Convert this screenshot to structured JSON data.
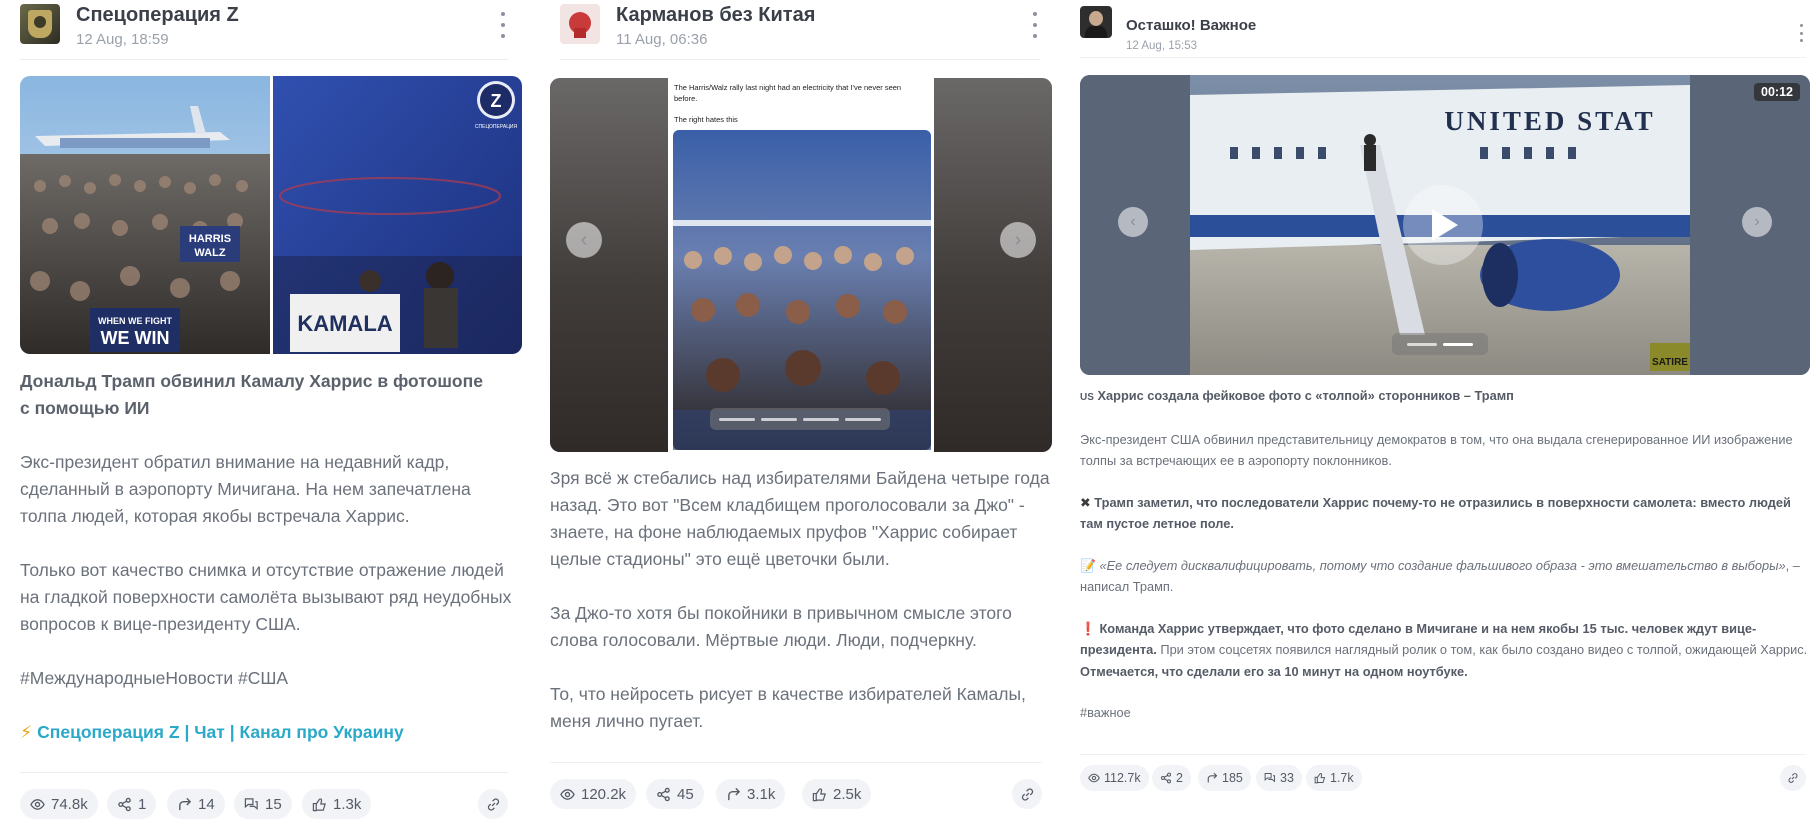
{
  "posts": [
    {
      "channel": "Спецоперация Z",
      "date": "12 Aug, 18:59",
      "title_line1": "Дональд Трамп обвинил Камалу Харрис в фотошопе",
      "title_line2": "с помощью ИИ",
      "paragraphs": [
        "Экс-президент обратил внимание на недавний кадр, сделанный в аэропорту Мичигана. На нем запечатлена толпа людей, которая якобы встречала Харрис.",
        "Только вот качество снимка и отсутствие отражение людей на гладкой поверхности самолёта вызывают ряд неудобных вопросов к вице-президенту США.",
        "#МеждународныеНовости #США"
      ],
      "links": {
        "emoji": "⚡",
        "channel": "Спецоперация Z",
        "sep": "|",
        "chat": "Чат",
        "ukraine": "Канал про Украину"
      },
      "image_texts": {
        "sign1": "HARRIS",
        "sign1b": "WALZ",
        "sign2": "WHEN WE FIGHT",
        "sign2b": "WE WIN",
        "sign3": "KAMALA",
        "badge": "Z",
        "badge_sub": "СПЕЦОПЕРАЦИЯ"
      },
      "stats": {
        "views": "74.8k",
        "shares": "1",
        "forwards": "14",
        "comments": "15",
        "likes": "1.3k"
      }
    },
    {
      "channel": "Карманов без Китая",
      "date": "11 Aug, 06:36",
      "paragraphs": [
        "Зря всё ж стебались над избирателями Байдена четыре года назад. Это вот \"Всем кладбищем проголосовали за Джо\" - знаете, на фоне наблюдаемых пруфов \"Харрис собирает целые стадионы\" это ещё цветочки были.",
        "За Джо-то хотя бы покойники в привычном смысле этого слова голосовали. Мёртвые люди. Люди, подчеркну.",
        "То, что нейросеть рисует в качестве избирателей Камалы, меня лично пугает."
      ],
      "image_texts": {
        "tweet1": "The Harris/Walz rally last night had an electricity that I've never seen before.",
        "tweet2": "The right hates this"
      },
      "stats": {
        "views": "120.2k",
        "shares": "45",
        "forwards": "3.1k",
        "likes": "2.5k"
      }
    },
    {
      "channel": "Осташко! Важное",
      "date": "12 Aug, 15:53",
      "video_duration": "00:12",
      "video_texts": {
        "plane": "UNITED STAT",
        "satire": "SATIRE"
      },
      "headline_flag": "US",
      "headline": "Харрис создала фейковое фото с «толпой» сторонников – Трамп",
      "p1": "Экс-президент США обвинил представительницу демократов в том, что она выдала сгенерированное ИИ изображение толпы за встречающих ее в аэропорту поклонников.",
      "p2_icon": "✖",
      "p2": "Трамп заметил, что последователи Харрис почему-то не отразились в поверхности самолета: вместо людей там пустое летное поле.",
      "p3_icon": "📝",
      "p3_quote": "«Ее следует дисквалифицировать, потому что создание фальшивого образа - это вмешательство в выборы»",
      "p3_tail": ", – написал Трамп.",
      "p4_icon": "❗",
      "p4_bold": "Команда Харрис утверждает, что фото сделано в Мичигане и на нем якобы 15 тыс. человек ждут вице-президента.",
      "p4_text": " При этом соцсетях появился наглядный ролик о том, как было создано видео с толпой, ожидающей Харрис. ",
      "p4_bold2": "Отмечается, что сделали его за 10 минут на одном ноутбуке.",
      "hashtag": "#важное",
      "stats": {
        "views": "112.7k",
        "shares": "2",
        "forwards": "185",
        "comments": "33",
        "likes": "1.7k"
      }
    }
  ],
  "icons": {
    "views": "eye-icon",
    "shares": "share-icon",
    "forwards": "forward-icon",
    "comments": "comments-icon",
    "likes": "thumbs-up-icon",
    "link": "link-icon",
    "more": "kebab-menu-icon",
    "prev": "chevron-left-icon",
    "next": "chevron-right-icon",
    "play": "play-icon"
  },
  "colors": {
    "accent_link": "#2aa9c9",
    "pill_bg": "#f1f3f6",
    "divider": "#eceff3"
  }
}
